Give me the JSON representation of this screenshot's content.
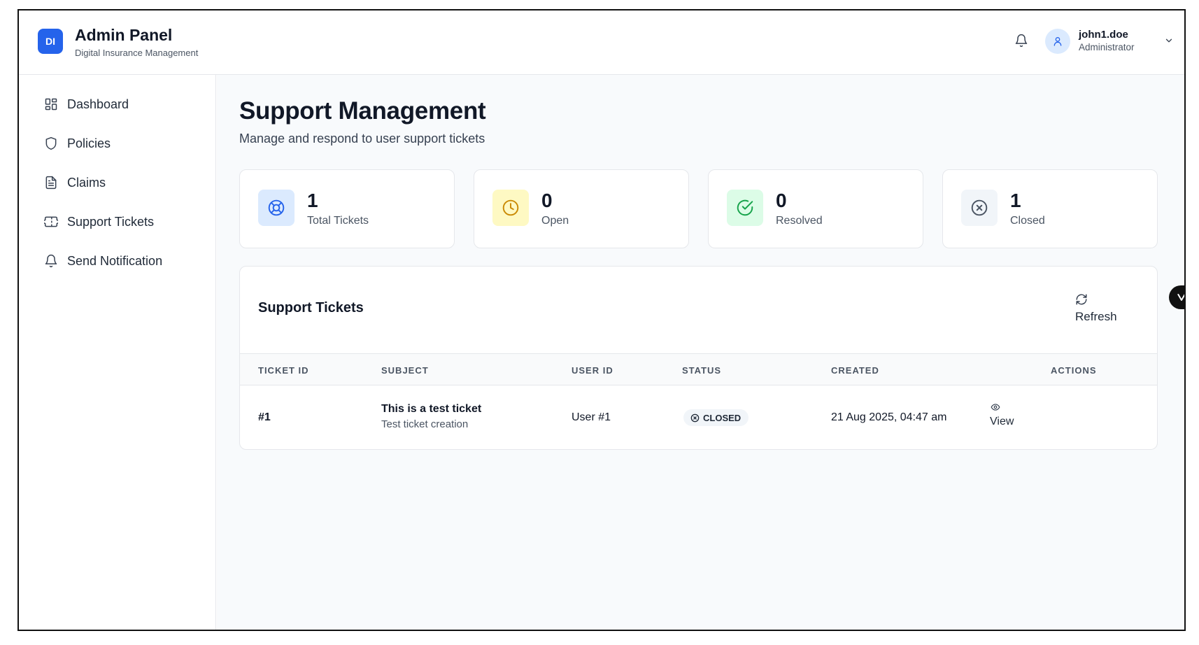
{
  "header": {
    "logo_text": "DI",
    "title": "Admin Panel",
    "subtitle": "Digital Insurance Management",
    "user": {
      "name": "john1.doe",
      "role": "Administrator"
    }
  },
  "sidebar": {
    "items": [
      {
        "label": "Dashboard",
        "icon": "dashboard-icon"
      },
      {
        "label": "Policies",
        "icon": "shield-icon"
      },
      {
        "label": "Claims",
        "icon": "document-icon"
      },
      {
        "label": "Support Tickets",
        "icon": "ticket-icon"
      },
      {
        "label": "Send Notification",
        "icon": "bell-icon"
      }
    ]
  },
  "main": {
    "title": "Support Management",
    "subtitle": "Manage and respond to user support tickets",
    "stats": [
      {
        "value": "1",
        "label": "Total Tickets",
        "icon": "lifebuoy-icon",
        "color": "#2563eb",
        "bg": "#dbeafe"
      },
      {
        "value": "0",
        "label": "Open",
        "icon": "clock-icon",
        "color": "#ca8a04",
        "bg": "#fef9c3"
      },
      {
        "value": "0",
        "label": "Resolved",
        "icon": "check-circle-icon",
        "color": "#16a34a",
        "bg": "#dcfce7"
      },
      {
        "value": "1",
        "label": "Closed",
        "icon": "x-circle-icon",
        "color": "#4b5563",
        "bg": "#f1f5f9"
      }
    ],
    "tickets_panel": {
      "title": "Support Tickets",
      "refresh_label": "Refresh",
      "columns": [
        "TICKET ID",
        "SUBJECT",
        "USER ID",
        "STATUS",
        "CREATED",
        "ACTIONS"
      ],
      "rows": [
        {
          "id": "#1",
          "subject": "This is a test ticket",
          "description": "Test ticket creation",
          "user_id": "User #1",
          "status": "CLOSED",
          "created": "21 Aug 2025, 04:47 am",
          "action": "View"
        }
      ]
    }
  }
}
